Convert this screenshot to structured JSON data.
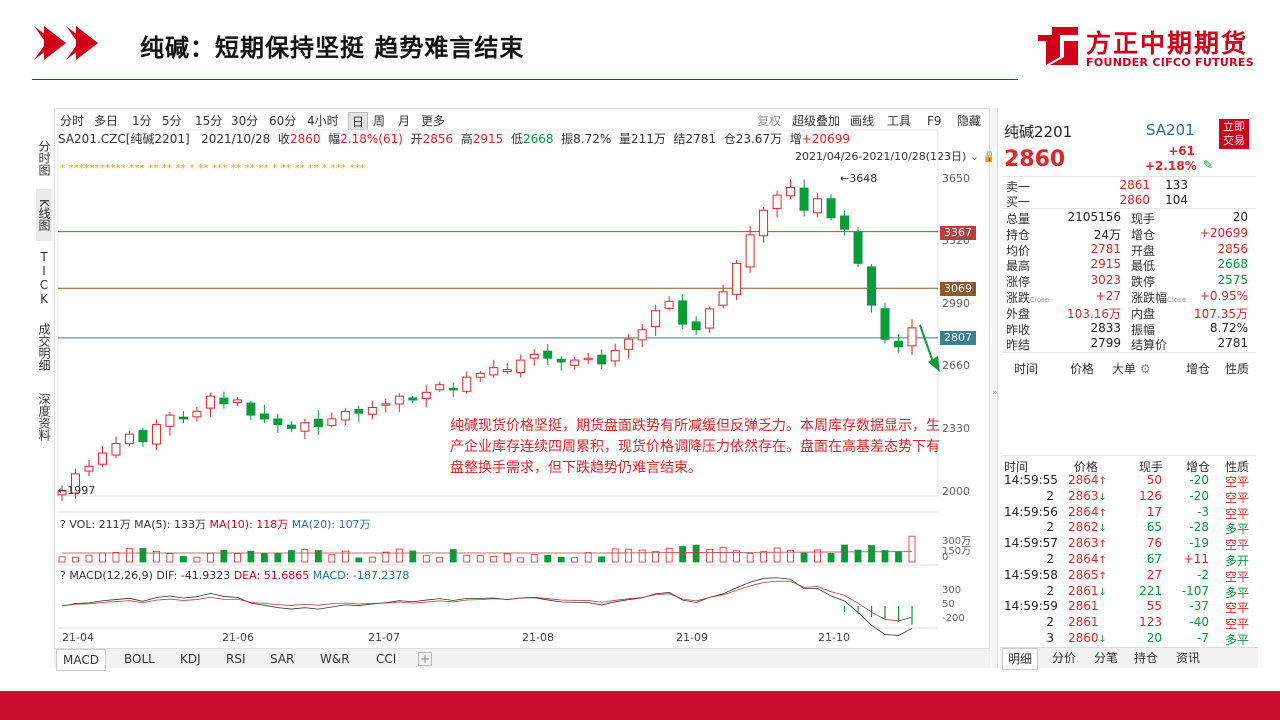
{
  "slide": {
    "title": "纯碱：短期保持坚挺 趋势难言结束",
    "logo_cn": "方正中期期货",
    "logo_en": "FOUNDER CIFCO FUTURES",
    "colors": {
      "brand_red": "#d0021b",
      "up_red": "#e0262b",
      "down_green": "#0a9b3a"
    }
  },
  "toolbar": {
    "periods": [
      "分时",
      "多日",
      "1分",
      "5分",
      "15分",
      "30分",
      "60分",
      "4小时",
      "日",
      "周",
      "月",
      "更多"
    ],
    "active_period": "日",
    "tools": [
      "复权",
      "超级叠加",
      "画线",
      "工具",
      "F9",
      "隐藏"
    ]
  },
  "side_tabs": [
    "分时图",
    "K线图",
    "TICK",
    "成交明细",
    "深度资料"
  ],
  "quote_line": {
    "code": "SA201.CZC[纯碱2201]",
    "date": "2021/10/28",
    "close_label": "收",
    "close": "2860",
    "amp_label": "幅",
    "amp": "2.18%(61)",
    "open_label": "开",
    "open": "2856",
    "high_label": "高",
    "high": "2915",
    "low_label": "低",
    "low": "2668",
    "swing_label": "振",
    "swing": "8.72%",
    "vol_label": "量",
    "vol": "211万",
    "settle_label": "结",
    "settle": "2781",
    "oi_label": "仓",
    "oi": "23.67万",
    "oi_chg_label": "增",
    "oi_chg": "+20699"
  },
  "range_text": "2021/04/26-2021/10/28(123日)",
  "stars_text": "* *********** *** ** ** ** * ** *** ** ** ** * ** ** ** * *** ***",
  "chart_data": {
    "type": "candlestick",
    "y_axis_ticks": [
      "3650",
      "3320",
      "2990",
      "2660",
      "2330",
      "2000"
    ],
    "x_axis_ticks": [
      "21-04",
      "21-06",
      "21-07",
      "21-08",
      "21-09",
      "21-10"
    ],
    "price_lines": [
      {
        "label": "3367",
        "color": "#c23b3b"
      },
      {
        "label": "3069",
        "color": "#8b5a2b"
      },
      {
        "label": "2807",
        "color": "#3d7f8f"
      }
    ],
    "high_mark": "3648",
    "low_mark": "1997",
    "close_points": [
      2000,
      2090,
      2130,
      2200,
      2250,
      2300,
      2260,
      2350,
      2400,
      2380,
      2420,
      2500,
      2460,
      2480,
      2400,
      2380,
      2350,
      2330,
      2360,
      2340,
      2380,
      2420,
      2410,
      2440,
      2460,
      2500,
      2480,
      2520,
      2560,
      2540,
      2600,
      2620,
      2650,
      2640,
      2690,
      2720,
      2700,
      2680,
      2690,
      2700,
      2670,
      2740,
      2800,
      2850,
      2950,
      3000,
      2880,
      2850,
      2960,
      3050,
      3200,
      3350,
      3480,
      3560,
      3600,
      3480,
      3540,
      3440,
      3380,
      3200,
      2980,
      2800,
      2760,
      2860
    ]
  },
  "annotation": "纯碱现货价格坚挺，期货盘面跌势有所减缓但反弹乏力。本周库存数据显示，生产企业库存连续四周累积，现货价格调降压力依然存在。盘面在高基差态势下有盘整换手需求，但下跌趋势仍难言结束。",
  "vol_panel": {
    "label": "VOL: 211万",
    "ma5": "MA(5): 133万",
    "ma10": "MA(10): 118万",
    "ma20": "MA(20): 107万",
    "ticks": [
      "300万",
      "150万",
      "0"
    ]
  },
  "macd_panel": {
    "label": "MACD(12,26,9)",
    "dif": "DIF: -41.9323",
    "dea": "DEA: 51.6865",
    "macd": "MACD: -187.2378",
    "ticks": [
      "300",
      "50",
      "-200"
    ]
  },
  "bottom_tabs": [
    "MACD",
    "BOLL",
    "KDJ",
    "RSI",
    "SAR",
    "W&R",
    "CCI"
  ],
  "right_panel": {
    "name": "纯碱2201",
    "code": "SA201",
    "trade_btn": "立即交易",
    "price": "2860",
    "change": "+61",
    "change_pct": "+2.18%",
    "sell1_label": "卖一",
    "sell1_price": "2861",
    "sell1_vol": "133",
    "buy1_label": "买一",
    "buy1_price": "2860",
    "buy1_vol": "104",
    "stats": [
      [
        "总量",
        "2105156",
        "现手",
        "20"
      ],
      [
        "持仓",
        "24万",
        "增仓",
        "+20699"
      ],
      [
        "均价",
        "2781",
        "开盘",
        "2856"
      ],
      [
        "最高",
        "2915",
        "最低",
        "2668"
      ],
      [
        "涨停",
        "3023",
        "跌停",
        "2575"
      ],
      [
        "涨跌",
        "+27",
        "涨跌幅",
        "+0.95%"
      ],
      [
        "外盘",
        "103.16万",
        "内盘",
        "107.35万"
      ],
      [
        "昨收",
        "2833",
        "振幅",
        "8.72%"
      ],
      [
        "昨结",
        "2799",
        "结算价",
        "2781"
      ]
    ],
    "close_tag": "Close",
    "big_head": [
      "时间",
      "价格",
      "大单",
      "增仓",
      "性质"
    ],
    "ticks_head": [
      "时间",
      "价格",
      "现手",
      "增仓",
      "性质"
    ],
    "ticks": [
      [
        "14:59:55",
        "2864",
        "up",
        "50",
        "-20",
        "空平"
      ],
      [
        "2",
        "2863",
        "down",
        "126",
        "-20",
        "空平"
      ],
      [
        "14:59:56",
        "2864",
        "up",
        "17",
        "-3",
        "空平"
      ],
      [
        "2",
        "2862",
        "down",
        "65",
        "-28",
        "多平"
      ],
      [
        "14:59:57",
        "2863",
        "up",
        "76",
        "-19",
        "空平"
      ],
      [
        "2",
        "2864",
        "up",
        "67",
        "+11",
        "多开"
      ],
      [
        "14:59:58",
        "2865",
        "up",
        "27",
        "-2",
        "空平"
      ],
      [
        "2",
        "2861",
        "down",
        "221",
        "-107",
        "多平"
      ],
      [
        "14:59:59",
        "2861",
        "",
        "55",
        "-37",
        "空平"
      ],
      [
        "2",
        "2861",
        "",
        "123",
        "-40",
        "空平"
      ],
      [
        "3",
        "2860",
        "down",
        "20",
        "-7",
        "多平"
      ]
    ],
    "bottom_tabs": [
      "明细",
      "分价",
      "分笔",
      "持仓",
      "资讯"
    ]
  }
}
